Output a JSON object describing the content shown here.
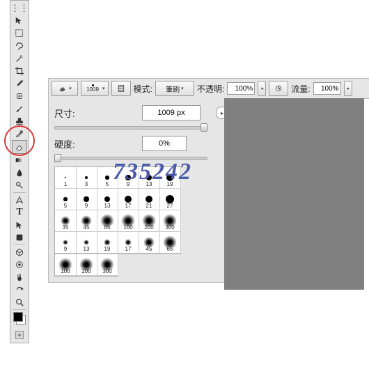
{
  "watermark": "735242",
  "options": {
    "brush_size": "1009",
    "mode_label": "模式:",
    "mode_value": "筆刷",
    "opacity_label": "不透明:",
    "opacity_value": "100%",
    "flow_label": "流量:",
    "flow_value": "100%"
  },
  "panel": {
    "size_label": "尺寸:",
    "size_value": "1009 px",
    "hardness_label": "硬度:",
    "hardness_value": "0%"
  },
  "presets": [
    [
      "1",
      "3",
      "5",
      "9",
      "13",
      "19"
    ],
    [
      "5",
      "9",
      "13",
      "17",
      "21",
      "27"
    ],
    [
      "35",
      "45",
      "65",
      "100",
      "200",
      "300"
    ],
    [
      "9",
      "13",
      "19",
      "17",
      "45",
      "65"
    ]
  ],
  "presets2": [
    "100",
    "200",
    "300"
  ],
  "tools": [
    "move",
    "marquee",
    "lasso",
    "wand",
    "crop",
    "eyedropper",
    "heal",
    "brush",
    "stamp",
    "history",
    "eraser",
    "gradient",
    "blur",
    "dodge",
    "pen",
    "type",
    "path",
    "shape",
    "hand",
    "zoom",
    "rotate",
    "3d",
    "camera",
    "switch"
  ]
}
